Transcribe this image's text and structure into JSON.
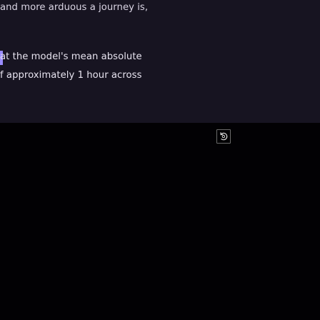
{
  "article": {
    "paragraph_1": "and more arduous a journey is,",
    "paragraph_2_line_1": "at the model's mean absolute",
    "paragraph_2_line_2": "f approximately 1 hour across"
  },
  "media": {
    "button_icon": "rotate-icon"
  }
}
